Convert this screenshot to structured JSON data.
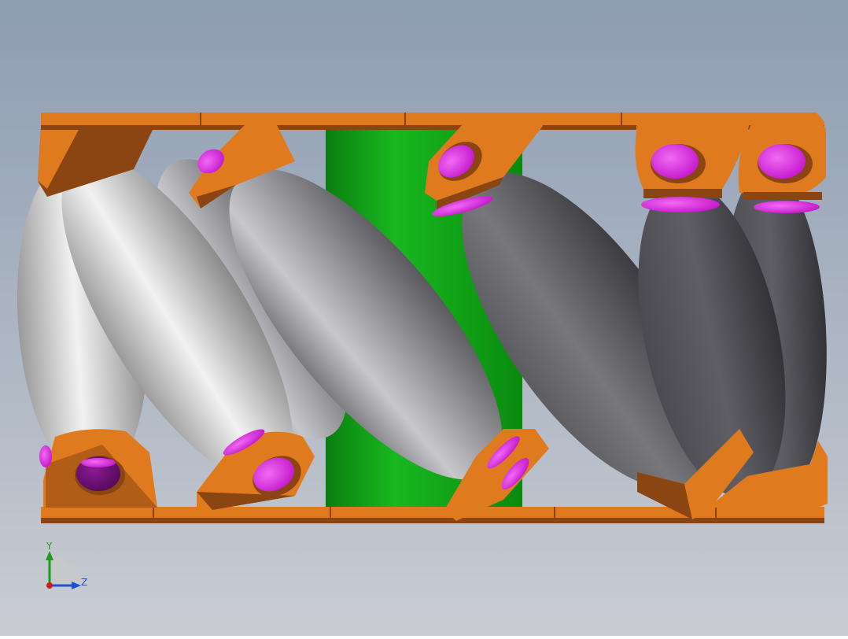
{
  "viewport": {
    "background_top": "#8d9db2",
    "background_bottom": "#c9ccd3",
    "subject": "mecanum-wheel-side-view"
  },
  "colors": {
    "frame_orange": "#e07a1f",
    "frame_dark": "#8a4512",
    "pin_magenta": "#e020e8",
    "pin_dark": "#6a0a70",
    "hub_green": "#12a318",
    "roller_light": "#d8d8d8",
    "roller_dark": "#4d4d52",
    "axis_y": "#1a9d1a",
    "axis_z": "#1f4fd6",
    "axis_origin": "#d11a1a"
  },
  "triad": {
    "y_label": "Y",
    "z_label": "Z"
  }
}
